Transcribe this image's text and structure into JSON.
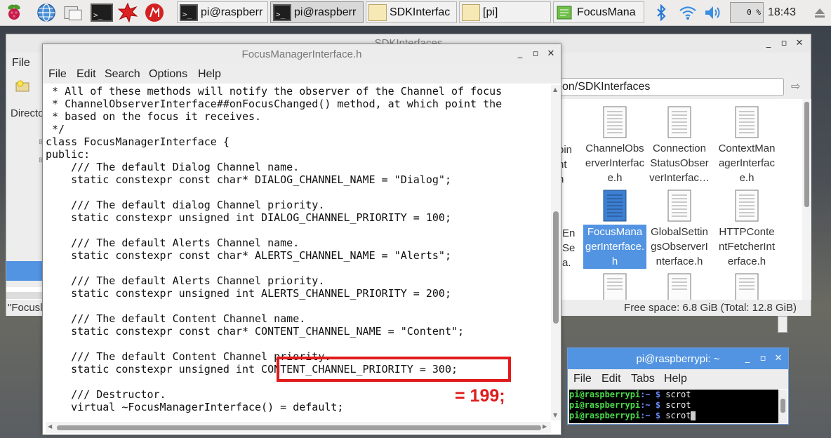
{
  "taskbar": {
    "tasks": [
      {
        "label": "pi@raspberr",
        "icon": "terminal-icon",
        "active": false
      },
      {
        "label": "pi@raspberr",
        "icon": "terminal-icon",
        "active": true
      },
      {
        "label": "SDKInterfac",
        "icon": "folder-icon",
        "active": false
      },
      {
        "label": "[pi]",
        "icon": "folder-icon",
        "active": false
      },
      {
        "label": "FocusMana",
        "icon": "text-editor-icon",
        "active": false
      }
    ],
    "cpu": "0 %",
    "clock": "18:43"
  },
  "file_manager": {
    "title": "SDKInterfaces",
    "menu_file": "File",
    "path": "on/SDKInterfaces",
    "directory_label": "Directo",
    "partial_items": [
      {
        "line1": "pin",
        "line2": "nt",
        "line3": "h"
      },
      {
        "line1": "En",
        "line2": "Se",
        "line3": "a."
      }
    ],
    "files": [
      {
        "l1": "ChannelObs",
        "l2": "erverInterfac",
        "l3": "e.h"
      },
      {
        "l1": "Connection",
        "l2": "StatusObser",
        "l3": "verInterfac…"
      },
      {
        "l1": "ContextMan",
        "l2": "agerInterfac",
        "l3": "e.h"
      },
      {
        "l1": "FocusMana",
        "l2": "gerInterface.",
        "l3": "h"
      },
      {
        "l1": "GlobalSettin",
        "l2": "gsObserverI",
        "l3": "nterface.h"
      },
      {
        "l1": "HTTPConte",
        "l2": "ntFetcherInt",
        "l3": "erface.h"
      }
    ],
    "status_left": "\"Focusl",
    "status_right": "Free space: 6.8 GiB (Total: 12.8 GiB)"
  },
  "editor": {
    "title": "FocusManagerInterface.h",
    "menu": [
      "File",
      "Edit",
      "Search",
      "Options",
      "Help"
    ],
    "lines": [
      " * All of these methods will notify the observer of the Channel of focus",
      " * ChannelObserverInterface##onFocusChanged() method, at which point the",
      " * based on the focus it receives.",
      " */",
      "class FocusManagerInterface {",
      "public:",
      "    /// The default Dialog Channel name.",
      "    static constexpr const char* DIALOG_CHANNEL_NAME = \"Dialog\";",
      "",
      "    /// The default dialog Channel priority.",
      "    static constexpr unsigned int DIALOG_CHANNEL_PRIORITY = 100;",
      "",
      "    /// The default Alerts Channel name.",
      "    static constexpr const char* ALERTS_CHANNEL_NAME = \"Alerts\";",
      "",
      "    /// The default Alerts Channel priority.",
      "    static constexpr unsigned int ALERTS_CHANNEL_PRIORITY = 200;",
      "",
      "    /// The default Content Channel name.",
      "    static constexpr const char* CONTENT_CHANNEL_NAME = \"Content\";",
      "",
      "    /// The default Content Channel priority.",
      "    static constexpr unsigned int CONTENT_CHANNEL_PRIORITY = 300;",
      "",
      "    /// Destructor.",
      "    virtual ~FocusManagerInterface() = default;"
    ],
    "annotation": "= 199;",
    "highlight_color": "#e01b1b"
  },
  "terminal": {
    "title": "pi@raspberrypi: ~",
    "menu": [
      "File",
      "Edit",
      "Tabs",
      "Help"
    ],
    "user": "pi@raspberrypi",
    "path_sep": ":~ $",
    "commands": [
      "scrot",
      "scrot",
      "scrot"
    ]
  },
  "colors": {
    "selection": "#5294e2",
    "annotation": "#e01b1b"
  }
}
